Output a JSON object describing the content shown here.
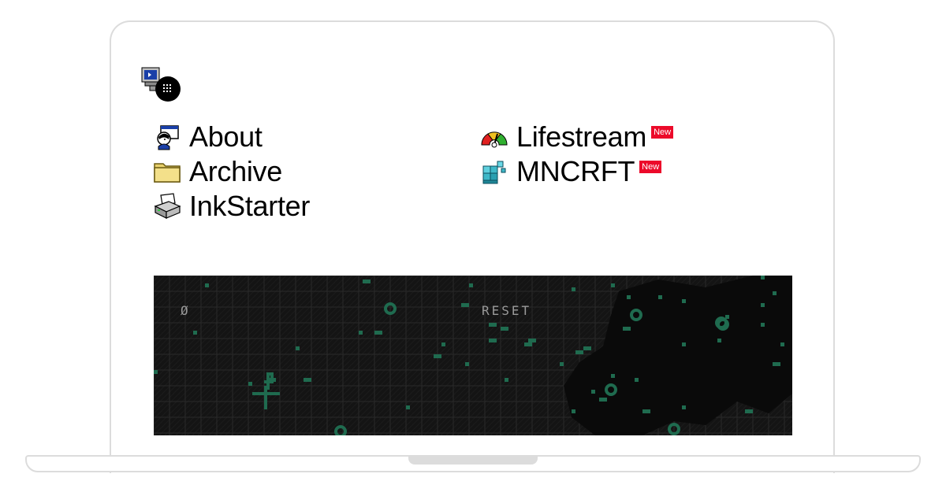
{
  "logo": {
    "icon": "computer-with-mascot-icon"
  },
  "nav": {
    "left": [
      {
        "label": "About",
        "icon": "user-card-icon"
      },
      {
        "label": "Archive",
        "icon": "folder-icon"
      },
      {
        "label": "InkStarter",
        "icon": "printer-icon"
      }
    ],
    "right": [
      {
        "label": "Lifestream",
        "icon": "gauge-icon",
        "badge": "New"
      },
      {
        "label": "MNCRFT",
        "icon": "blocks-icon",
        "badge": "New"
      }
    ]
  },
  "game": {
    "counter": "Ø",
    "reset_label": "RESET",
    "colors": {
      "background": "#141414",
      "cells": "#1f6b4f",
      "grid": "#2a2a2a"
    }
  },
  "colors": {
    "badge": "#ec0a2a",
    "frame": "#dcdcdc"
  }
}
